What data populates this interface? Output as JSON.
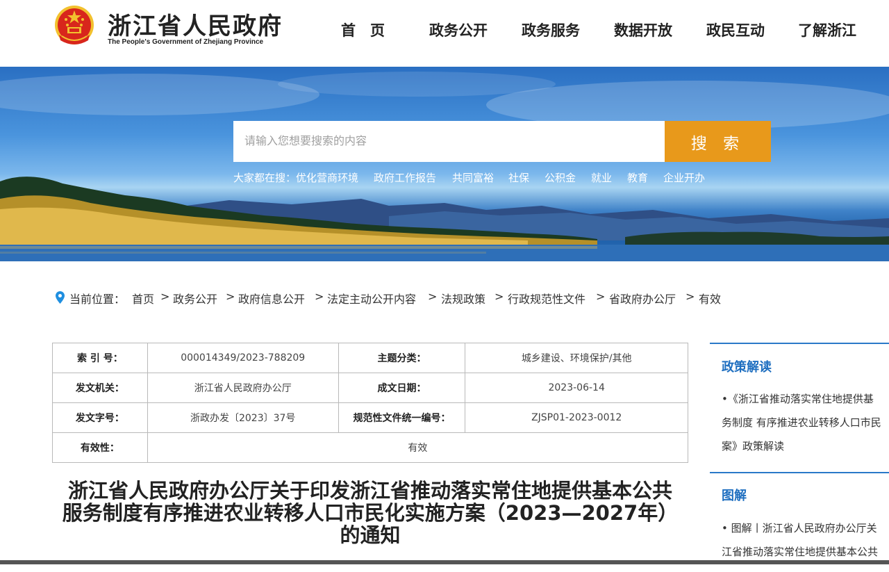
{
  "header": {
    "title": "浙江省人民政府",
    "subtitle": "The People's Government of Zhejiang Province",
    "nav": [
      "首　页",
      "政务公开",
      "政务服务",
      "数据开放",
      "政民互动",
      "了解浙江"
    ]
  },
  "search": {
    "placeholder": "请输入您想要搜索的内容",
    "button": "搜 索",
    "hot_prefix": "大家都在搜：",
    "hot": [
      "优化营商环境",
      "政府工作报告",
      "共同富裕",
      "社保",
      "公积金",
      "就业",
      "教育",
      "企业开办"
    ]
  },
  "breadcrumb": {
    "label": "当前位置：",
    "items": [
      "首页",
      "政务公开",
      "政府信息公开",
      "法定主动公开内容",
      "法规政策",
      "行政规范性文件",
      "省政府办公厅",
      "有效"
    ],
    "separator": ">"
  },
  "meta": {
    "index_label": "索 引 号：",
    "index_value": "000014349/2023-788209",
    "topic_label": "主题分类：",
    "topic_value": "城乡建设、环境保护/其他",
    "issuer_label": "发文机关：",
    "issuer_value": "浙江省人民政府办公厅",
    "date_label": "成文日期：",
    "date_value": "2023-06-14",
    "docno_label": "发文字号：",
    "docno_value": "浙政办发〔2023〕37号",
    "code_label": "规范性文件统一编号：",
    "code_value": "ZJSP01-2023-0012",
    "validity_label": "有效性：",
    "validity_value": "有效"
  },
  "document": {
    "title_line1": "浙江省人民政府办公厅关于印发浙江省推动落实常住地提供基本公共",
    "title_line2": "服务制度有序推进农业转移人口市民化实施方案（2023—2027年）",
    "title_line3": "的通知"
  },
  "sidebar": {
    "policy_head": "政策解读",
    "policy_line1": "•《浙江省推动落实常住地提供基",
    "policy_line2": "务制度 有序推进农业转移人口市民",
    "policy_line3": "案》政策解读",
    "graphic_head": "图解",
    "graphic_line1": "• 图解丨浙江省人民政府办公厅关",
    "graphic_line2": "江省推动落实常住地提供基本公共"
  },
  "colors": {
    "accent_orange": "#e8991b",
    "sidebar_blue": "#1f6fc0",
    "emblem_red": "#d8261c",
    "emblem_gold": "#f2c12e"
  }
}
